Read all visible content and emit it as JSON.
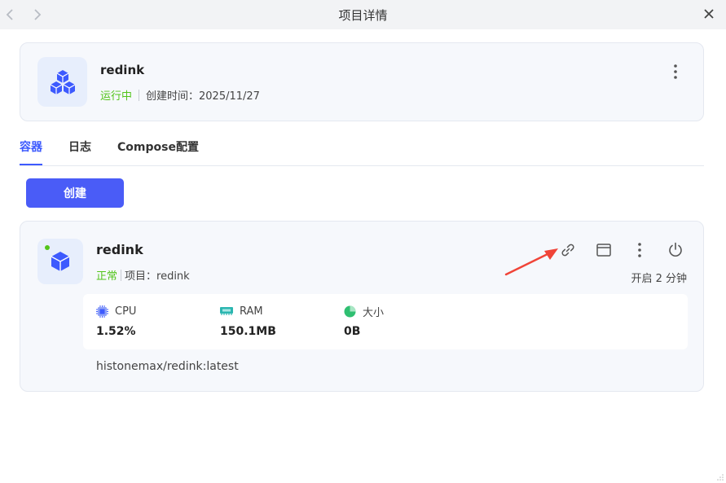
{
  "window": {
    "title": "项目详情"
  },
  "project": {
    "name": "redink",
    "status": "运行中",
    "created": "创建时间：2025/11/27"
  },
  "tabs": [
    {
      "label": "容器",
      "active": true
    },
    {
      "label": "日志",
      "active": false
    },
    {
      "label": "Compose配置",
      "active": false
    }
  ],
  "create_label": "创建",
  "container": {
    "name": "redink",
    "status": "正常",
    "project": "项目：redink",
    "uptime": "开启 2 分钟",
    "stats": {
      "cpu_label": "CPU",
      "cpu_value": "1.52%",
      "ram_label": "RAM",
      "ram_value": "150.1MB",
      "size_label": "大小",
      "size_value": "0B"
    },
    "image": "histonemax/redink:latest"
  },
  "colors": {
    "accent": "#4a5cf7",
    "running": "#52c41a",
    "annotation": "#f04438"
  },
  "icons": [
    "chevron-left-icon",
    "chevron-right-icon",
    "close-icon",
    "cubes-icon",
    "cube-icon",
    "more-vertical-icon",
    "link-icon",
    "terminal-window-icon",
    "power-icon",
    "cpu-icon",
    "ram-icon",
    "pie-chart-icon"
  ]
}
